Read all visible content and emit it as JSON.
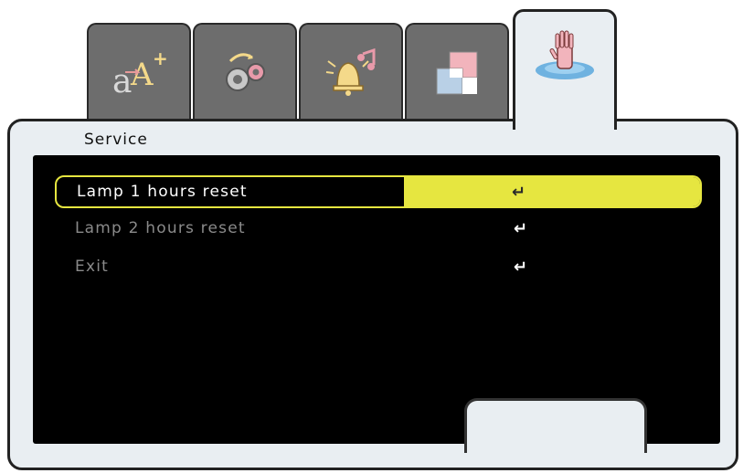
{
  "tabs": [
    {
      "name": "text-size-icon",
      "label": "aA+"
    },
    {
      "name": "settings-gears-icon",
      "label": ""
    },
    {
      "name": "alarm-music-icon",
      "label": ""
    },
    {
      "name": "layout-squares-icon",
      "label": ""
    },
    {
      "name": "service-hand-icon",
      "label": ""
    }
  ],
  "page": {
    "title": "Service"
  },
  "menu": {
    "items": [
      {
        "label": "Lamp 1 hours reset",
        "action_symbol": "↵",
        "state": "selected"
      },
      {
        "label": "Lamp 2 hours reset",
        "action_symbol": "↵",
        "state": "normal"
      },
      {
        "label": "Exit",
        "action_symbol": "↵",
        "state": "normal"
      }
    ]
  },
  "colors": {
    "frame": "#e9eef2",
    "tab_inactive": "#6d6d6d",
    "panel": "#000000",
    "highlight": "#e6e640",
    "text_dim": "#8a8a8a"
  }
}
